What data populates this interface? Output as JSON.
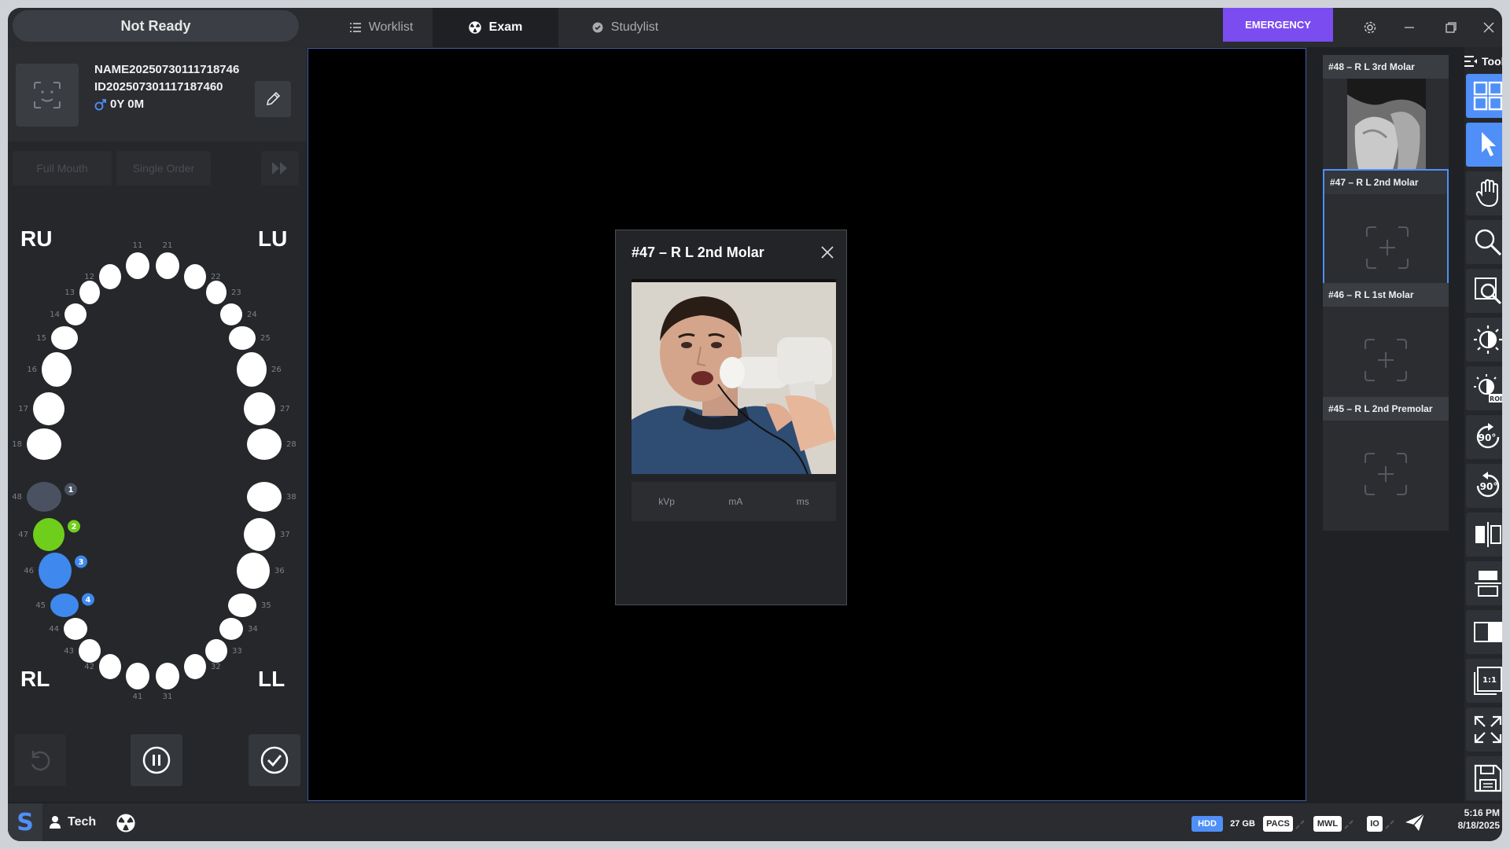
{
  "app": {
    "status": "Not Ready",
    "tabs": {
      "worklist": "Worklist",
      "exam": "Exam",
      "studylist": "Studylist"
    },
    "emergency": "EMERGENCY"
  },
  "patient": {
    "name": "NAME20250730111718746",
    "id": "ID202507301117187460",
    "age": "0Y 0M"
  },
  "modes": {
    "full_mouth": "Full Mouth",
    "single_order": "Single Order"
  },
  "quadrants": {
    "ru": "RU",
    "lu": "LU",
    "rl": "RL",
    "ll": "LL"
  },
  "tooth_numbers": [
    "11",
    "12",
    "13",
    "14",
    "15",
    "16",
    "17",
    "18",
    "21",
    "22",
    "23",
    "24",
    "25",
    "26",
    "27",
    "28",
    "31",
    "32",
    "33",
    "34",
    "35",
    "36",
    "37",
    "38",
    "41",
    "42",
    "43",
    "44",
    "45",
    "46",
    "47",
    "48"
  ],
  "selected_teeth": [
    {
      "number": "48",
      "order": "1",
      "color": "#4a5262"
    },
    {
      "number": "47",
      "order": "2",
      "color": "#6fce1c"
    },
    {
      "number": "46",
      "order": "3",
      "color": "#3f88ee"
    },
    {
      "number": "45",
      "order": "4",
      "color": "#3f88ee"
    }
  ],
  "modal": {
    "title": "#47 – R L 2nd Molar",
    "exposure": {
      "kvp": "kVp",
      "ma": "mA",
      "ms": "ms"
    }
  },
  "thumbnails": [
    {
      "label": "#48 – R L 3rd Molar",
      "has_image": true
    },
    {
      "label": "#47 – R L 2nd Molar",
      "selected": true
    },
    {
      "label": "#46 – R L 1st Molar"
    },
    {
      "label": "#45 – R L 2nd Premolar"
    }
  ],
  "toolbar": {
    "title": "Tool",
    "tools": [
      "layout-grid-icon",
      "pointer-icon",
      "hand-pan-icon",
      "zoom-icon",
      "magnifier-icon",
      "brightness-icon",
      "roi-brightness-icon",
      "rotate-ccw-90-icon",
      "rotate-cw-90-icon",
      "flip-horizontal-icon",
      "flip-vertical-icon",
      "invert-icon",
      "one-to-one-icon",
      "fit-screen-icon",
      "save-icon"
    ],
    "rotate_label": "90°",
    "roi_label": "ROI",
    "one_to_one_label": "1:1"
  },
  "statusbar": {
    "user": "Tech",
    "hdd_label": "HDD",
    "hdd_free": "27 GB",
    "pacs": "PACS",
    "mwl": "MWL",
    "io": "IO",
    "time": "5:16 PM",
    "date": "8/18/2025"
  },
  "colors": {
    "accent": "#4f8ff7",
    "emergency": "#7b4cf0",
    "green": "#6fce1c"
  }
}
